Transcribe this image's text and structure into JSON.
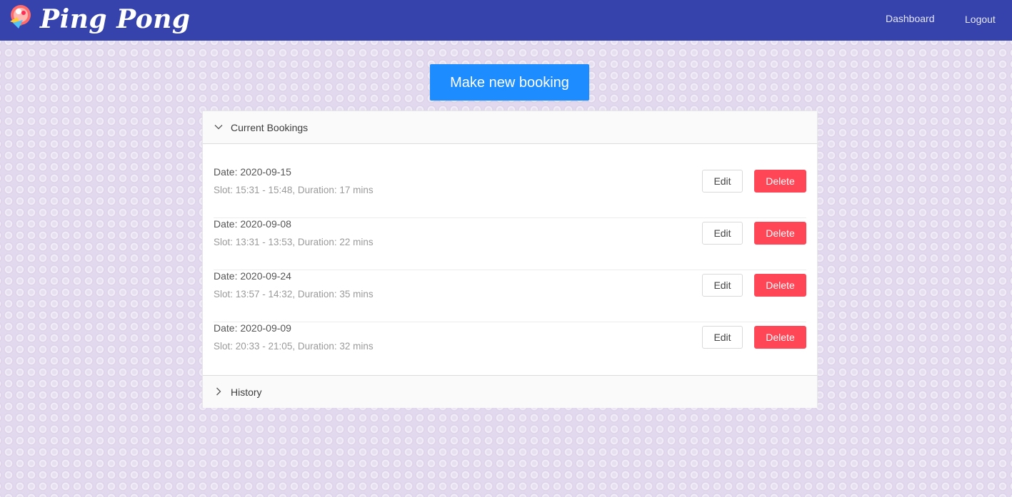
{
  "header": {
    "brand": "Ping Pong",
    "logo_icon": "ping-pong-logo-icon",
    "nav": {
      "dashboard": "Dashboard",
      "logout": "Logout"
    },
    "color": "#3643ac"
  },
  "cta": {
    "label": "Make new booking",
    "color": "#1d8cff"
  },
  "panels": {
    "current": {
      "title": "Current Bookings",
      "icon": "chevron-down-icon",
      "bookings": [
        {
          "date": "Date: 2020-09-15",
          "slot": "Slot: 15:31 - 15:48, Duration: 17 mins",
          "edit": "Edit",
          "delete": "Delete"
        },
        {
          "date": "Date: 2020-09-08",
          "slot": "Slot: 13:31 - 13:53, Duration: 22 mins",
          "edit": "Edit",
          "delete": "Delete"
        },
        {
          "date": "Date: 2020-09-24",
          "slot": "Slot: 13:57 - 14:32, Duration: 35 mins",
          "edit": "Edit",
          "delete": "Delete"
        },
        {
          "date": "Date: 2020-09-09",
          "slot": "Slot: 20:33 - 21:05, Duration: 32 mins",
          "edit": "Edit",
          "delete": "Delete"
        }
      ]
    },
    "history": {
      "title": "History",
      "icon": "chevron-right-icon"
    }
  },
  "colors": {
    "delete": "#ff4656",
    "background": "#e2d9ee"
  }
}
